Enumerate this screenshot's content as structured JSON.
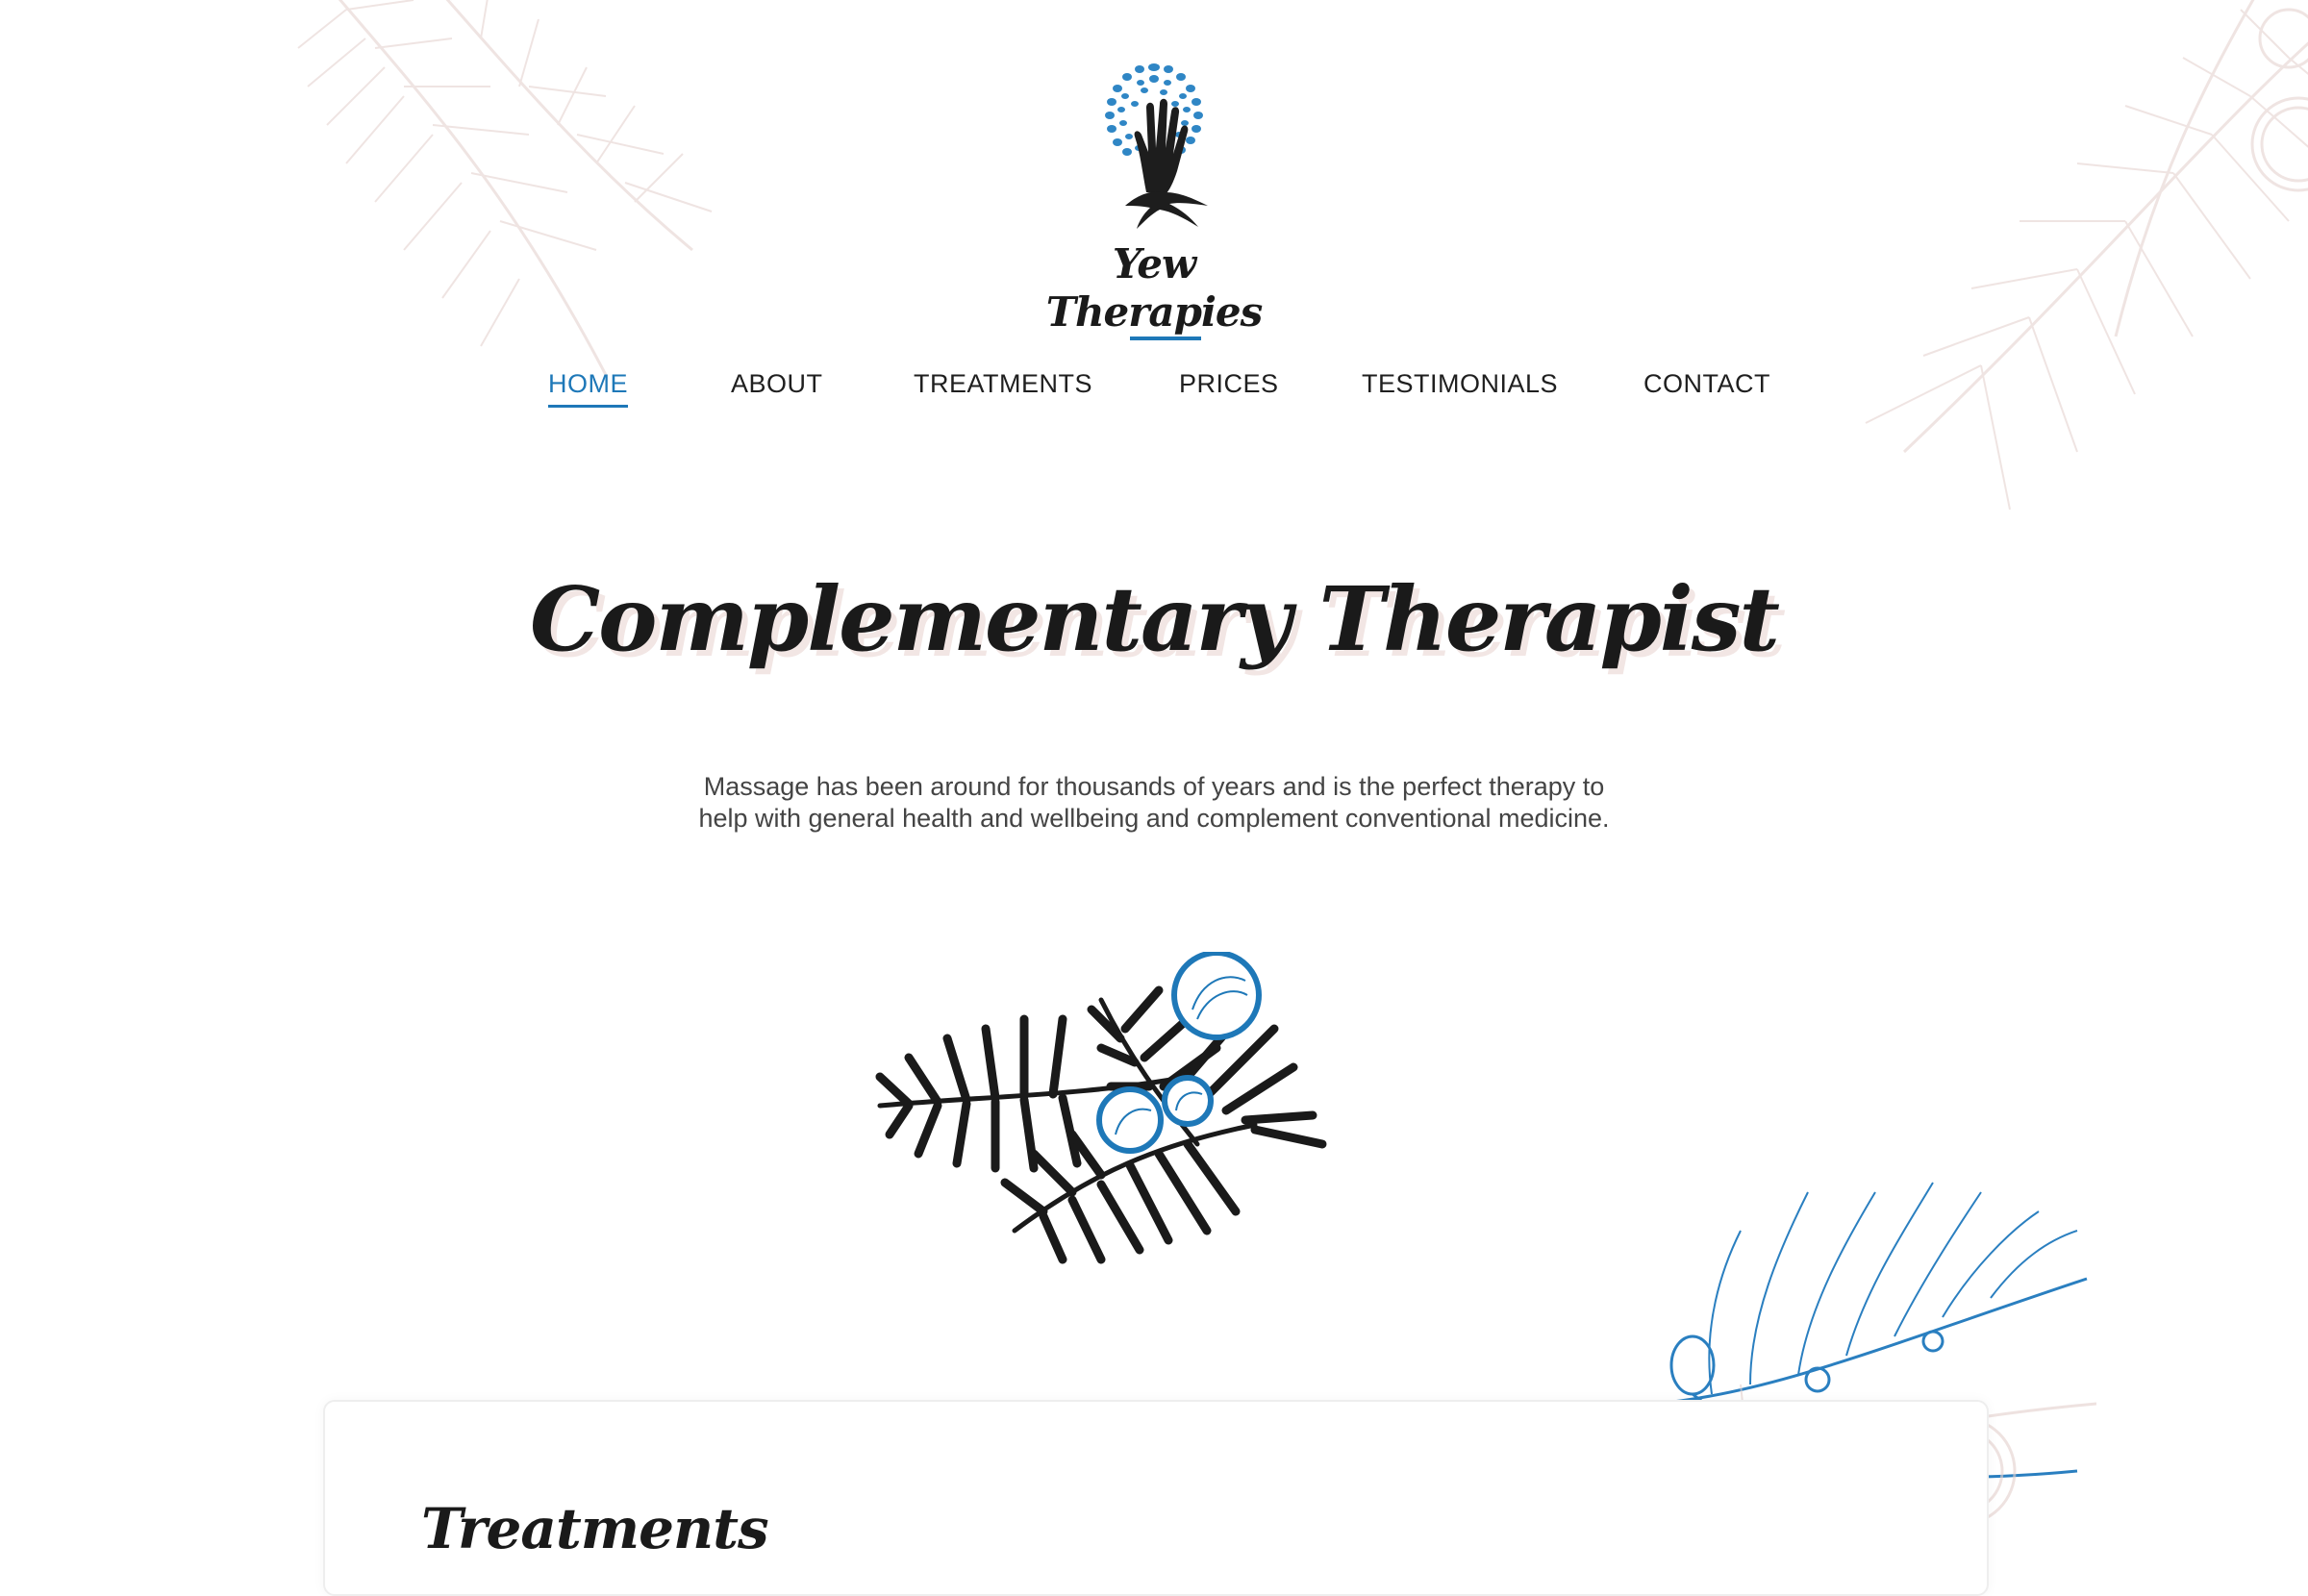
{
  "brand": {
    "name": "Yew Therapies",
    "accent_color": "#1e78b8",
    "logo_icon": "hand-tree-logo-icon"
  },
  "nav": {
    "items": [
      {
        "label": "HOME",
        "active": true
      },
      {
        "label": "ABOUT",
        "active": false
      },
      {
        "label": "TREATMENTS",
        "active": false
      },
      {
        "label": "PRICES",
        "active": false
      },
      {
        "label": "TESTIMONIALS",
        "active": false
      },
      {
        "label": "CONTACT",
        "active": false
      }
    ]
  },
  "hero": {
    "title": "Complementary Therapist",
    "description_line1": "Massage has been around for thousands of years and is the perfect therapy to",
    "description_line2": "help with general health and wellbeing and complement conventional medicine.",
    "illustration_icon": "yew-branch-berries-icon"
  },
  "section": {
    "title": "Treatments"
  },
  "colors": {
    "decor_pink": "#e9d9d6",
    "text_dark": "#1a1a1a",
    "text_body": "#444444"
  }
}
